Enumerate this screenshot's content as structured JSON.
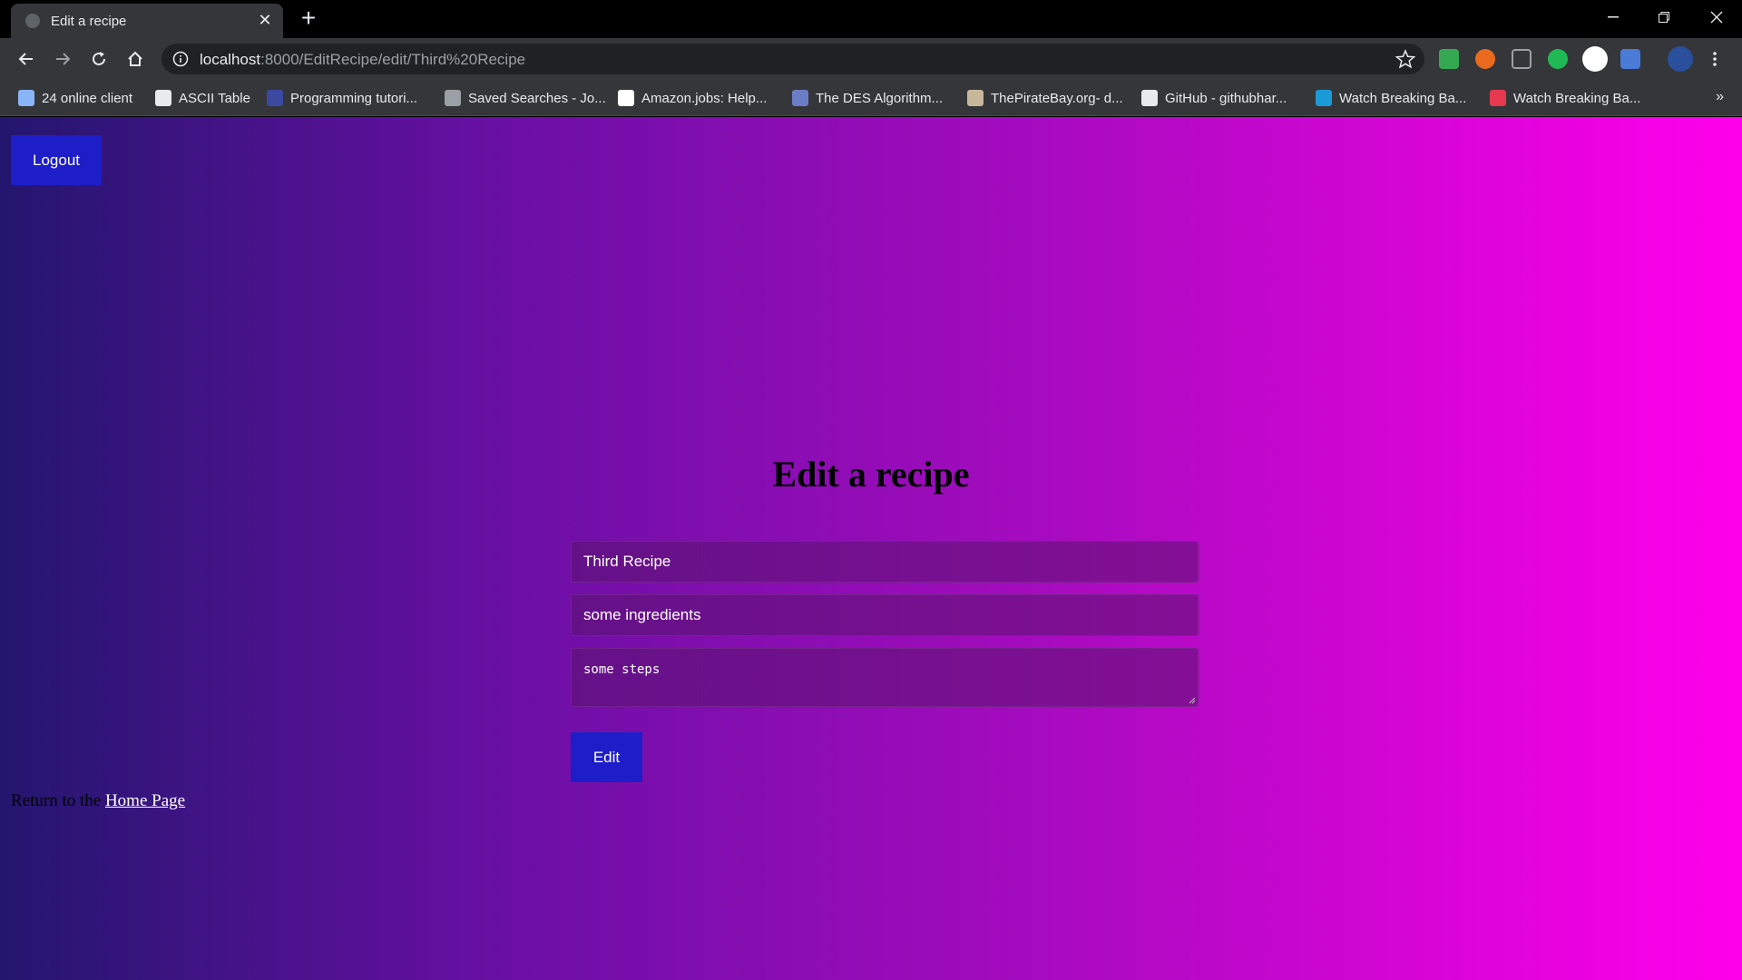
{
  "browser": {
    "tab_title": "Edit a recipe",
    "new_tab": "+",
    "url_host": "localhost",
    "url_rest": ":8000/EditRecipe/edit/Third%20Recipe",
    "bookmarks": [
      {
        "label": "24 online client",
        "color": "#8ab4f8"
      },
      {
        "label": "ASCII Table",
        "color": "#e8eaed"
      },
      {
        "label": "Programming tutori...",
        "color": "#3b4aa0"
      },
      {
        "label": "Saved Searches - Jo...",
        "color": "#9aa0a6"
      },
      {
        "label": "Amazon.jobs: Help...",
        "color": "#ffffff"
      },
      {
        "label": "The DES Algorithm...",
        "color": "#6b7dc4"
      },
      {
        "label": "ThePirateBay.org- d...",
        "color": "#c9b79c"
      },
      {
        "label": "GitHub - githubhar...",
        "color": "#e8eaed"
      },
      {
        "label": "Watch Breaking Ba...",
        "color": "#1a9bd7"
      },
      {
        "label": "Watch Breaking Ba...",
        "color": "#e53950"
      }
    ],
    "bookmarks_more": "»"
  },
  "page": {
    "logout_label": "Logout",
    "title": "Edit a recipe",
    "name_value": "Third Recipe",
    "ingredients_value": "some ingredients",
    "steps_value": "some steps",
    "edit_label": "Edit",
    "return_text": "Return to the ",
    "home_link": "Home Page"
  }
}
